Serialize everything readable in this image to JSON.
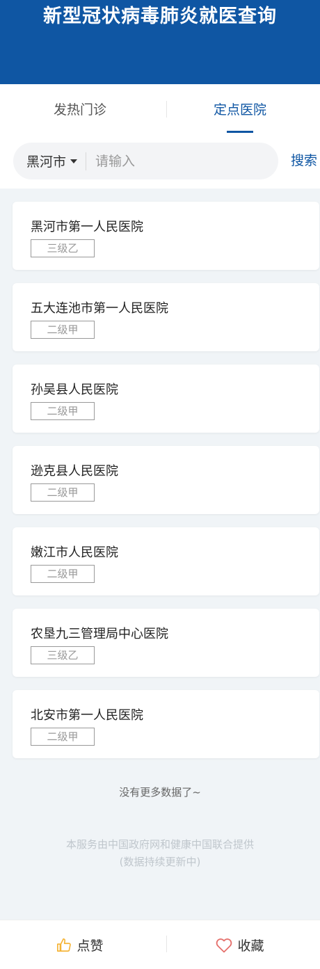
{
  "header": {
    "title": "新型冠状病毒肺炎就医查询"
  },
  "tabs": [
    {
      "label": "发热门诊",
      "active": false
    },
    {
      "label": "定点医院",
      "active": true
    }
  ],
  "search": {
    "city": "黑河市",
    "placeholder": "请输入",
    "button_label": "搜索"
  },
  "hospitals": [
    {
      "name": "黑河市第一人民医院",
      "level": "三级乙"
    },
    {
      "name": "五大连池市第一人民医院",
      "level": "二级甲"
    },
    {
      "name": "孙吴县人民医院",
      "level": "二级甲"
    },
    {
      "name": "逊克县人民医院",
      "level": "二级甲"
    },
    {
      "name": "嫩江市人民医院",
      "level": "二级甲"
    },
    {
      "name": "农垦九三管理局中心医院",
      "level": "三级乙"
    },
    {
      "name": "北安市第一人民医院",
      "level": "二级甲"
    }
  ],
  "list_end_text": "没有更多数据了~",
  "footer": {
    "line1": "本服务由中国政府网和健康中国联合提供",
    "line2": "(数据持续更新中)"
  },
  "actions": {
    "like_label": "点赞",
    "favorite_label": "收藏"
  },
  "colors": {
    "primary": "#0f56a3",
    "like_icon": "#f5b335",
    "favorite_icon": "#e5706c"
  },
  "icons": {
    "like": "thumbs-up-icon",
    "favorite": "heart-icon",
    "dropdown": "caret-down-icon"
  }
}
